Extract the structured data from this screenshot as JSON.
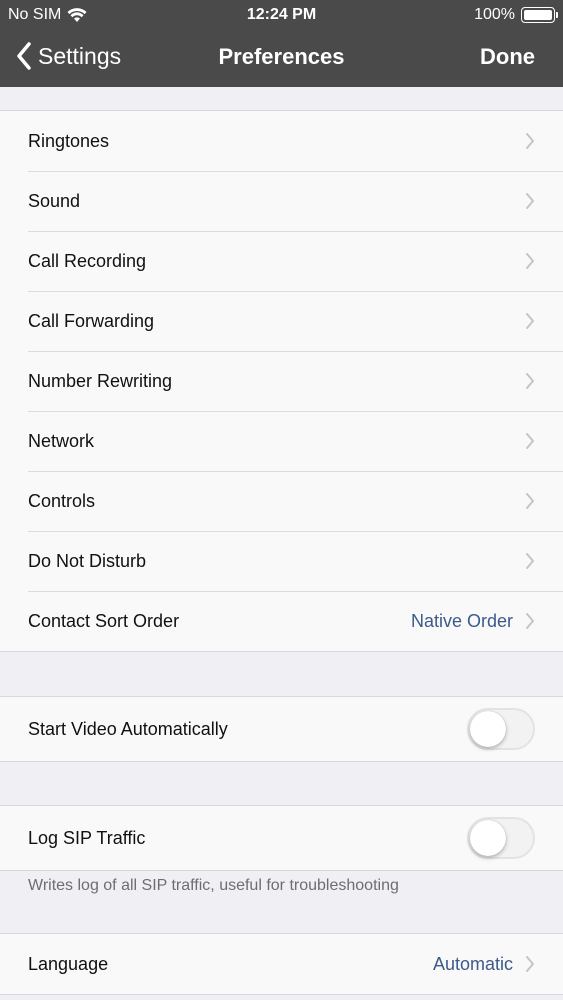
{
  "status": {
    "carrier": "No SIM",
    "time": "12:24 PM",
    "battery": "100%",
    "battery_level": 1.0
  },
  "nav": {
    "back_label": "Settings",
    "title": "Preferences",
    "done_label": "Done"
  },
  "groups": {
    "main": [
      {
        "label": "Ringtones"
      },
      {
        "label": "Sound"
      },
      {
        "label": "Call Recording"
      },
      {
        "label": "Call Forwarding"
      },
      {
        "label": "Number Rewriting"
      },
      {
        "label": "Network"
      },
      {
        "label": "Controls"
      },
      {
        "label": "Do Not Disturb"
      },
      {
        "label": "Contact Sort Order",
        "value": "Native Order"
      }
    ],
    "video": {
      "label": "Start Video Automatically",
      "enabled": false
    },
    "sip": {
      "label": "Log SIP Traffic",
      "enabled": false,
      "footnote": "Writes log of all SIP traffic, useful for troubleshooting"
    },
    "language": {
      "label": "Language",
      "value": "Automatic"
    }
  },
  "colors": {
    "navbar": "#4a4a4a",
    "value_text": "#3c5a8a",
    "background": "#efeff4"
  },
  "icons": {
    "back": "chevron-left-icon",
    "disclosure": "chevron-right-icon",
    "wifi": "wifi-icon",
    "battery": "battery-icon"
  }
}
